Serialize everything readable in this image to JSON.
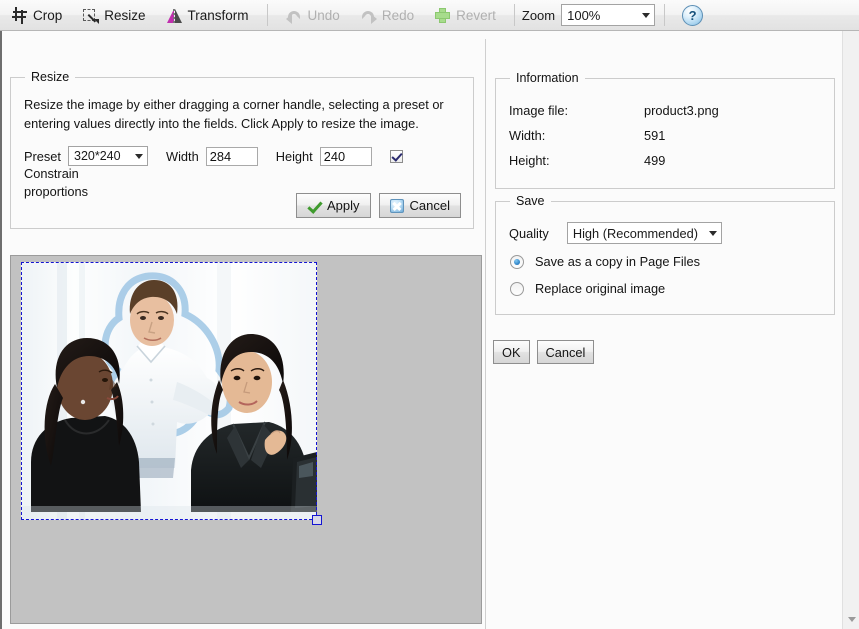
{
  "toolbar": {
    "crop_label": "Crop",
    "resize_label": "Resize",
    "transform_label": "Transform",
    "undo_label": "Undo",
    "redo_label": "Redo",
    "revert_label": "Revert",
    "zoom_label": "Zoom",
    "zoom_value": "100%",
    "help_label": "?"
  },
  "resize": {
    "legend": "Resize",
    "description": "Resize the image by either dragging a corner handle, selecting a preset or entering values directly into the fields. Click Apply to resize the image.",
    "preset_label": "Preset",
    "preset_value": "320*240",
    "width_label": "Width",
    "width_value": "284",
    "height_label": "Height",
    "height_value": "240",
    "constrain_label": "Constrain",
    "constrain_label2": "proportions",
    "constrain_checked": true,
    "apply_label": "Apply",
    "cancel_label": "Cancel"
  },
  "information": {
    "legend": "Information",
    "rows": [
      {
        "key": "Image file:",
        "value": "product3.png"
      },
      {
        "key": "Width:",
        "value": "591"
      },
      {
        "key": "Height:",
        "value": "499"
      }
    ]
  },
  "save": {
    "legend": "Save",
    "quality_label": "Quality",
    "quality_value": "High (Recommended)",
    "option_copy": "Save as a copy in Page Files",
    "option_replace": "Replace original image",
    "selected_option": "copy"
  },
  "dialog": {
    "ok_label": "OK",
    "cancel_label": "Cancel"
  },
  "colors": {
    "accent_blue": "#1414d2",
    "transform_magenta": "#c02fae",
    "revert_green": "#a7dc8c",
    "canvas_gray": "#c2c2c2"
  }
}
